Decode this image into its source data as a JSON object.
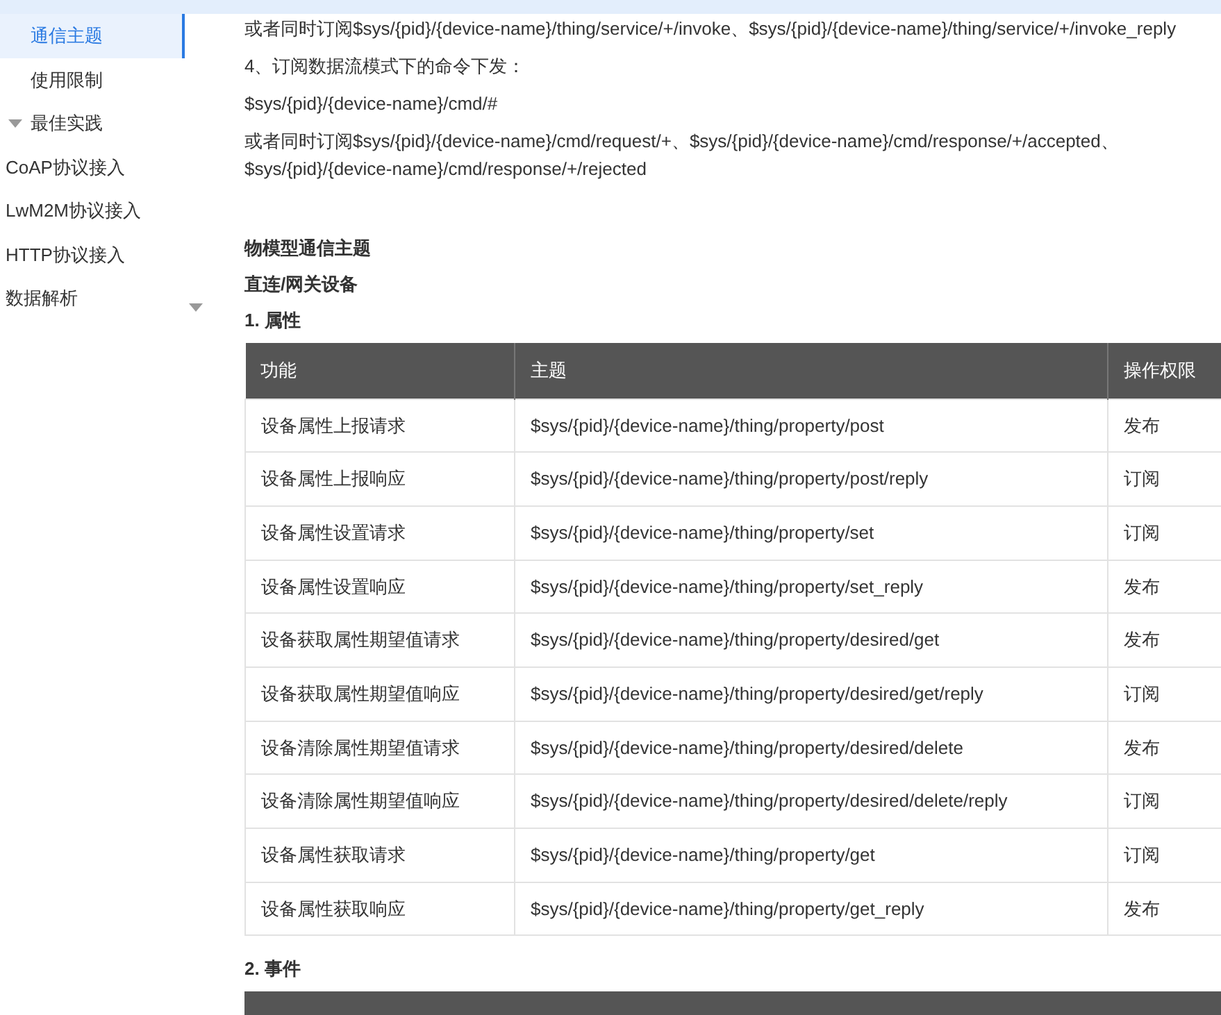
{
  "sidebar": {
    "items": [
      {
        "children": [
          {
            "label": "通信主题",
            "selected": true
          },
          {
            "label": "使用限制",
            "selected": false
          },
          {
            "label": "最佳实践",
            "selected": false,
            "expanded": true
          }
        ]
      },
      {
        "label": "CoAP协议接入",
        "selected": false
      },
      {
        "label": "LwM2M协议接入",
        "selected": false
      },
      {
        "label": "HTTP协议接入",
        "selected": false
      },
      {
        "label": "数据解析",
        "selected": false
      }
    ]
  },
  "intro": [
    "或者同时订阅$sys/{pid}/{device-name}/thing/service/+/invoke、$sys/{pid}/{device-name}/thing/service/+/invoke_reply",
    "4、订阅数据流模式下的命令下发：",
    "$sys/{pid}/{device-name}/cmd/#",
    "或者同时订阅$sys/{pid}/{device-name}/cmd/request/+、$sys/{pid}/{device-name}/cmd/response/+/accepted、$sys/{pid}/{device-name}/cmd/response/+/rejected"
  ],
  "section_title": "物模型通信主题",
  "subsection_title": "直连/网关设备",
  "tables": [
    {
      "title": "1. 属性",
      "columns": [
        "功能",
        "主题",
        "操作权限"
      ],
      "rows": [
        [
          "设备属性上报请求",
          "$sys/{pid}/{device-name}/thing/property/post",
          "发布"
        ],
        [
          "设备属性上报响应",
          "$sys/{pid}/{device-name}/thing/property/post/reply",
          "订阅"
        ],
        [
          "设备属性设置请求",
          "$sys/{pid}/{device-name}/thing/property/set",
          "订阅"
        ],
        [
          "设备属性设置响应",
          "$sys/{pid}/{device-name}/thing/property/set_reply",
          "发布"
        ],
        [
          "设备获取属性期望值请求",
          "$sys/{pid}/{device-name}/thing/property/desired/get",
          "发布"
        ],
        [
          "设备获取属性期望值响应",
          "$sys/{pid}/{device-name}/thing/property/desired/get/reply",
          "订阅"
        ],
        [
          "设备清除属性期望值请求",
          "$sys/{pid}/{device-name}/thing/property/desired/delete",
          "发布"
        ],
        [
          "设备清除属性期望值响应",
          "$sys/{pid}/{device-name}/thing/property/desired/delete/reply",
          "订阅"
        ],
        [
          "设备属性获取请求",
          "$sys/{pid}/{device-name}/thing/property/get",
          "订阅"
        ],
        [
          "设备属性获取响应",
          "$sys/{pid}/{device-name}/thing/property/get_reply",
          "发布"
        ]
      ]
    },
    {
      "title": "2. 事件"
    }
  ]
}
